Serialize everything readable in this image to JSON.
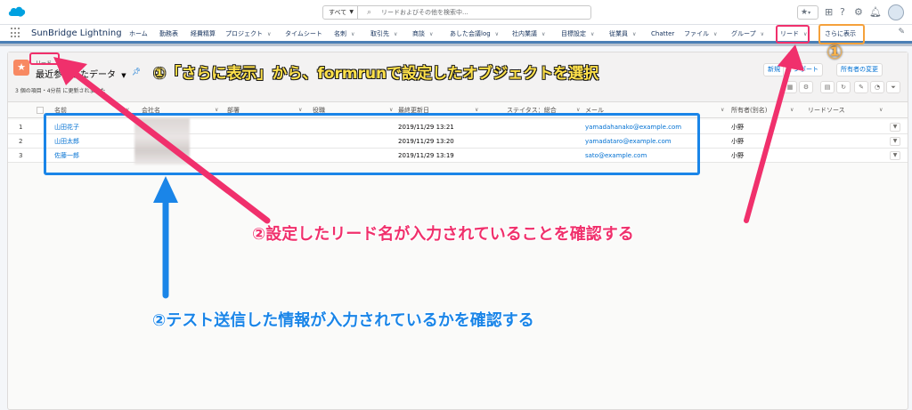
{
  "header": {
    "search_scope": "すべて",
    "search_placeholder": "リードおよびその他を検索中..."
  },
  "nav": {
    "app_name": "SunBridge Lightning",
    "items": [
      {
        "label": "ホーム",
        "chevron": false
      },
      {
        "label": "勤務表",
        "chevron": false
      },
      {
        "label": "経費精算",
        "chevron": false
      },
      {
        "label": "プロジェクト",
        "chevron": true
      },
      {
        "label": "タイムシート",
        "chevron": false
      },
      {
        "label": "名刺",
        "chevron": true
      },
      {
        "label": "取引先",
        "chevron": true
      },
      {
        "label": "商談",
        "chevron": true
      },
      {
        "label": "あした会議log",
        "chevron": true
      },
      {
        "label": "社内業議",
        "chevron": true
      },
      {
        "label": "目標設定",
        "chevron": true
      },
      {
        "label": "従業員",
        "chevron": true
      },
      {
        "label": "Chatter",
        "chevron": false
      },
      {
        "label": "ファイル",
        "chevron": true
      },
      {
        "label": "グループ",
        "chevron": true
      },
      {
        "label": "リード",
        "chevron": true
      },
      {
        "label": "さらに表示",
        "chevron": false
      }
    ]
  },
  "list_view": {
    "object_label": "リード",
    "view_name": "最近参照したデータ",
    "count_text": "3 個の項目・4分前 に更新されました",
    "new_button": "新規",
    "import_button": "インポート",
    "assign_button": "所有者の変更",
    "columns": [
      "名前",
      "会社名",
      "部署",
      "役職",
      "最終更新日",
      "ステイタス：総合",
      "メール",
      "所有者(別名)",
      "リードソース"
    ],
    "rows": [
      {
        "num": "1",
        "name": "山田花子",
        "updated": "2019/11/29 13:21",
        "email": "yamadahanako@example.com",
        "owner": "小野"
      },
      {
        "num": "2",
        "name": "山田太郎",
        "updated": "2019/11/29 13:20",
        "email": "yamadataro@example.com",
        "owner": "小野"
      },
      {
        "num": "3",
        "name": "佐藤一郎",
        "updated": "2019/11/29 13:19",
        "email": "sato@example.com",
        "owner": "小野"
      }
    ]
  },
  "annotations": {
    "step1_mark": "①",
    "step1_text": "①「さらに表示」から、formrunで設定したオブジェクトを選択",
    "step2a_text": "②設定したリード名が入力されていることを確認する",
    "step2b_text": "②テスト送信した情報が入力されているかを確認する",
    "colors": {
      "pink": "#f0306c",
      "orange": "#f5a13b",
      "blue": "#1a85e8",
      "yellow": "#ffe14a"
    }
  }
}
